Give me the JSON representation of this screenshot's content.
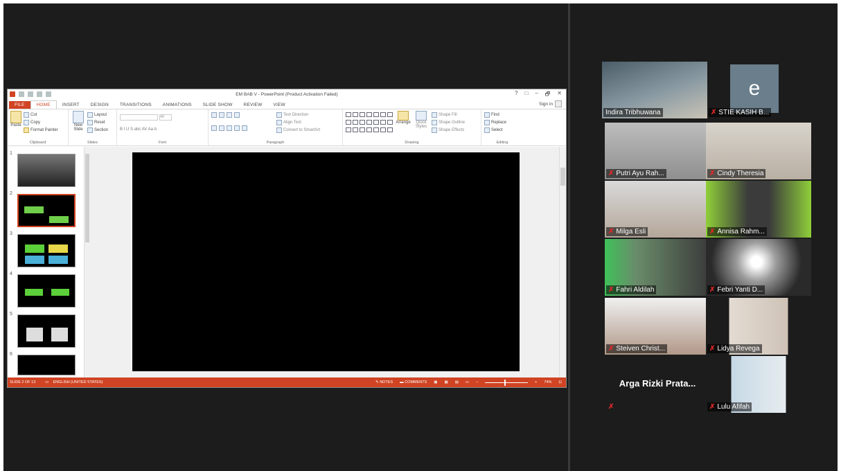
{
  "ppt": {
    "title": "EM BAB V - PowerPoint (Product Activation Failed)",
    "tabs": [
      "FILE",
      "HOME",
      "INSERT",
      "DESIGN",
      "TRANSITIONS",
      "ANIMATIONS",
      "SLIDE SHOW",
      "REVIEW",
      "VIEW"
    ],
    "sign_in": "Sign in",
    "window_buttons": [
      "?",
      "□",
      "–",
      "🗗",
      "✕"
    ],
    "ribbon": {
      "clipboard": {
        "paste": "Paste",
        "cut": "Cut",
        "copy": "Copy",
        "format_painter": "Format Painter",
        "label": "Clipboard"
      },
      "slides": {
        "new_slide": "New Slide",
        "layout": "Layout",
        "reset": "Reset",
        "section": "Section",
        "label": "Slides"
      },
      "font": {
        "label": "Font",
        "size": "40",
        "format": "B  I  U  S  abc  AV  Aa  A"
      },
      "paragraph": {
        "text_direction": "Text Direction",
        "align_text": "Align Text",
        "convert": "Convert to SmartArt",
        "label": "Paragraph"
      },
      "drawing": {
        "arrange": "Arrange",
        "quick_styles": "Quick Styles",
        "shape_fill": "Shape Fill",
        "shape_outline": "Shape Outline",
        "shape_effects": "Shape Effects",
        "label": "Drawing"
      },
      "editing": {
        "find": "Find",
        "replace": "Replace",
        "select": "Select",
        "label": "Editing"
      }
    },
    "slide_numbers": [
      "1",
      "2",
      "3",
      "4",
      "5",
      "6"
    ],
    "status": {
      "slide_of": "SLIDE 2 OF 13",
      "language": "ENGLISH (UNITED STATES)",
      "notes": "NOTES",
      "comments": "COMMENTS",
      "zoom": "74%"
    }
  },
  "participants": [
    {
      "name": "Indira Tribhuwana",
      "muted": false
    },
    {
      "name": "STIE KASIH B...",
      "muted": true,
      "avatar_letter": "e"
    },
    {
      "name": "Putri Ayu Rah...",
      "muted": true
    },
    {
      "name": "Cindy Theresia",
      "muted": true
    },
    {
      "name": "Milga Esli",
      "muted": true
    },
    {
      "name": "Annisa Rahm...",
      "muted": true
    },
    {
      "name": "Fahri Aldilah",
      "muted": true
    },
    {
      "name": "Febri Yanti D...",
      "muted": true
    },
    {
      "name": "Steiven Christ...",
      "muted": true
    },
    {
      "name": "Lidya Revega",
      "muted": true
    },
    {
      "name": "Arga Rizki Prata...",
      "muted": true
    },
    {
      "name": "Lulu Afifah",
      "muted": true
    }
  ],
  "colors": {
    "accent": "#d04423",
    "background": "#1c1c1c",
    "mute_icon": "#e02828"
  }
}
